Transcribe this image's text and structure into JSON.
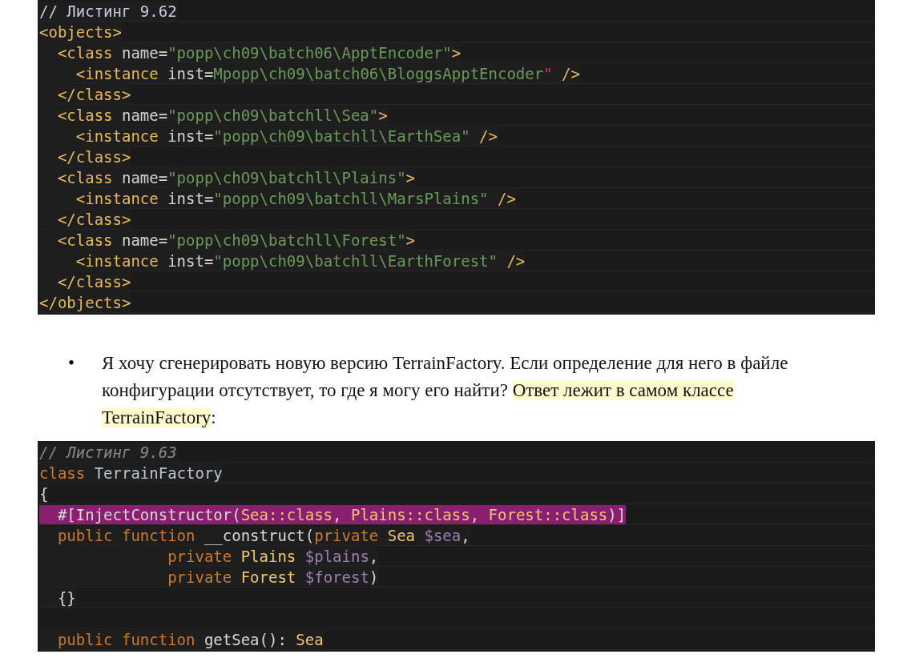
{
  "listing_1": {
    "lines": [
      {
        "kind": "code",
        "tokens": [
          {
            "kind": "note",
            "text": "// Листинг 9.62"
          }
        ]
      },
      {
        "kind": "code",
        "tokens": [
          {
            "kind": "tag",
            "text": "<objects>"
          }
        ]
      },
      {
        "kind": "code",
        "tokens": [
          {
            "kind": "tag",
            "text": "  <class "
          },
          {
            "kind": "attr",
            "text": "name="
          },
          {
            "kind": "string",
            "text": "\"popp\\ch09\\batch06\\ApptEncoder\""
          },
          {
            "kind": "tag",
            "text": ">"
          }
        ]
      },
      {
        "kind": "code",
        "tokens": [
          {
            "kind": "tag",
            "text": "    <instance "
          },
          {
            "kind": "attr",
            "text": "inst="
          },
          {
            "kind": "string",
            "text": "Mpopp\\ch09\\batch06\\BloggsApptEncoder"
          },
          {
            "kind": "error",
            "text": "\""
          },
          {
            "kind": "tag",
            "text": " />"
          }
        ]
      },
      {
        "kind": "code",
        "tokens": [
          {
            "kind": "tag",
            "text": "  </class>"
          }
        ]
      },
      {
        "kind": "code",
        "tokens": [
          {
            "kind": "tag",
            "text": "  <class "
          },
          {
            "kind": "attr",
            "text": "name="
          },
          {
            "kind": "string",
            "text": "\"popp\\ch09\\batchll\\Sea\""
          },
          {
            "kind": "tag",
            "text": ">"
          }
        ]
      },
      {
        "kind": "code",
        "tokens": [
          {
            "kind": "tag",
            "text": "    <instance "
          },
          {
            "kind": "attr",
            "text": "inst="
          },
          {
            "kind": "string",
            "text": "\"popp\\ch09\\batchll\\EarthSea\""
          },
          {
            "kind": "tag",
            "text": " />"
          }
        ]
      },
      {
        "kind": "code",
        "tokens": [
          {
            "kind": "tag",
            "text": "  </class>"
          }
        ]
      },
      {
        "kind": "code",
        "tokens": [
          {
            "kind": "tag",
            "text": "  <class "
          },
          {
            "kind": "attr",
            "text": "name="
          },
          {
            "kind": "string",
            "text": "\"popp\\chO9\\batchll\\Plains\""
          },
          {
            "kind": "tag",
            "text": ">"
          }
        ]
      },
      {
        "kind": "code",
        "tokens": [
          {
            "kind": "tag",
            "text": "    <instance "
          },
          {
            "kind": "attr",
            "text": "inst="
          },
          {
            "kind": "string",
            "text": "\"popp\\ch09\\batchll\\MarsPlains\""
          },
          {
            "kind": "tag",
            "text": " />"
          }
        ]
      },
      {
        "kind": "code",
        "tokens": [
          {
            "kind": "tag",
            "text": "  </class>"
          }
        ]
      },
      {
        "kind": "code",
        "tokens": [
          {
            "kind": "tag",
            "text": "  <class "
          },
          {
            "kind": "attr",
            "text": "name="
          },
          {
            "kind": "string",
            "text": "\"popp\\ch09\\batchll\\Forest\""
          },
          {
            "kind": "tag",
            "text": ">"
          }
        ]
      },
      {
        "kind": "code",
        "tokens": [
          {
            "kind": "tag",
            "text": "    <instance "
          },
          {
            "kind": "attr",
            "text": "inst="
          },
          {
            "kind": "string",
            "text": "\"popp\\ch09\\batchll\\EarthForest\""
          },
          {
            "kind": "tag",
            "text": " />"
          }
        ]
      },
      {
        "kind": "code",
        "tokens": [
          {
            "kind": "tag",
            "text": "  </class>"
          }
        ]
      },
      {
        "kind": "code",
        "tokens": [
          {
            "kind": "tag",
            "text": "</objects>"
          }
        ]
      }
    ]
  },
  "bullet_item": {
    "bullet": "•",
    "parts": [
      {
        "text": "Я хочу сгенерировать новую версию TerrainFactory. Если определение для него в файле конфигурации отсутствует, то где я могу его найти? ",
        "highlighted": false
      },
      {
        "text": "Ответ лежит в самом классе TerrainFactory",
        "highlighted": true
      },
      {
        "text": ":",
        "highlighted": false
      }
    ]
  },
  "listing_2": {
    "lines": [
      {
        "kind": "code",
        "highlighted": false,
        "tokens": [
          {
            "kind": "comment",
            "text": "// Листинг 9.63"
          }
        ]
      },
      {
        "kind": "code",
        "highlighted": false,
        "tokens": [
          {
            "kind": "keyword",
            "text": "class "
          },
          {
            "kind": "name",
            "text": "TerrainFactory"
          }
        ]
      },
      {
        "kind": "code",
        "highlighted": false,
        "tokens": [
          {
            "kind": "plain",
            "text": "{"
          }
        ]
      },
      {
        "kind": "code",
        "highlighted": true,
        "tokens": [
          {
            "kind": "plain",
            "text": "  #[InjectConstructor("
          },
          {
            "kind": "type",
            "text": "Sea::class"
          },
          {
            "kind": "plain",
            "text": ", "
          },
          {
            "kind": "type",
            "text": "Plains::class"
          },
          {
            "kind": "plain",
            "text": ", "
          },
          {
            "kind": "type",
            "text": "Forest::class"
          },
          {
            "kind": "plain",
            "text": ")]"
          }
        ]
      },
      {
        "kind": "code",
        "highlighted": false,
        "tokens": [
          {
            "kind": "keyword",
            "text": "  public function "
          },
          {
            "kind": "plain",
            "text": "__construct("
          },
          {
            "kind": "keyword",
            "text": "private "
          },
          {
            "kind": "type",
            "text": "Sea "
          },
          {
            "kind": "var",
            "text": "$sea"
          },
          {
            "kind": "plain",
            "text": ","
          }
        ]
      },
      {
        "kind": "code",
        "highlighted": false,
        "tokens": [
          {
            "kind": "keyword",
            "text": "              private "
          },
          {
            "kind": "type",
            "text": "Plains "
          },
          {
            "kind": "var",
            "text": "$plains"
          },
          {
            "kind": "plain",
            "text": ","
          }
        ]
      },
      {
        "kind": "code",
        "highlighted": false,
        "tokens": [
          {
            "kind": "keyword",
            "text": "              private "
          },
          {
            "kind": "type",
            "text": "Forest "
          },
          {
            "kind": "var",
            "text": "$forest"
          },
          {
            "kind": "plain",
            "text": ")"
          }
        ]
      },
      {
        "kind": "code",
        "highlighted": false,
        "tokens": [
          {
            "kind": "plain",
            "text": "  {}"
          }
        ]
      },
      {
        "kind": "blank",
        "highlighted": false
      },
      {
        "kind": "code",
        "highlighted": false,
        "tokens": [
          {
            "kind": "keyword",
            "text": "  public function "
          },
          {
            "kind": "plain",
            "text": "getSea(): "
          },
          {
            "kind": "type",
            "text": "Sea"
          }
        ]
      }
    ]
  }
}
